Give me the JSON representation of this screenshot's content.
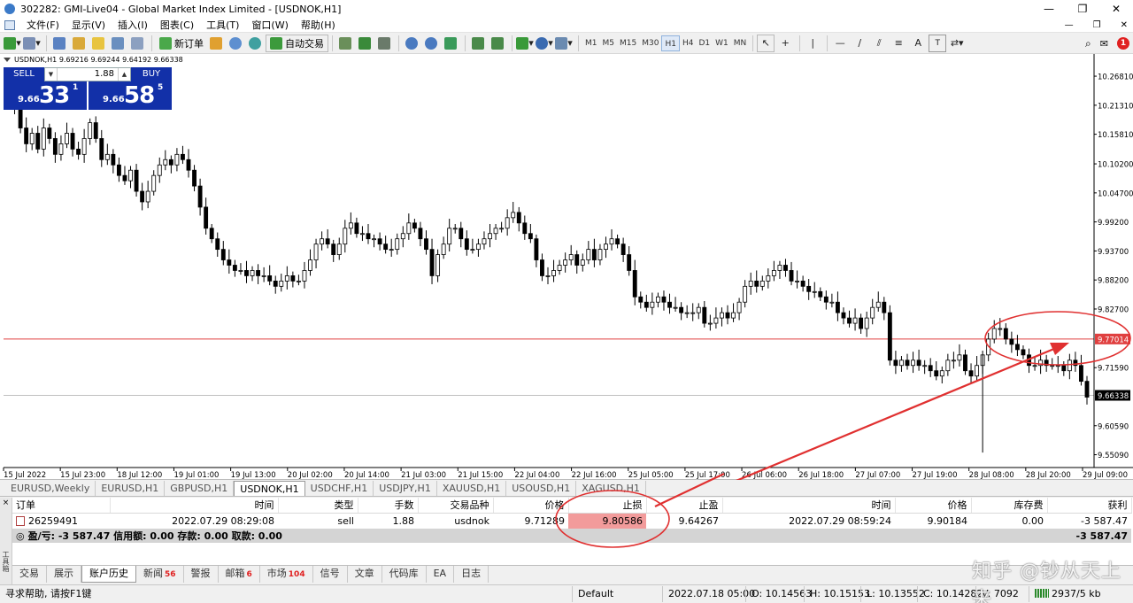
{
  "window": {
    "title": "302282: GMI-Live04 - Global Market Index Limited - [USDNOK,H1]",
    "controls": [
      "—",
      "❐",
      "✕"
    ]
  },
  "menu": {
    "items": [
      "文件(F)",
      "显示(V)",
      "插入(I)",
      "图表(C)",
      "工具(T)",
      "窗口(W)",
      "帮助(H)"
    ],
    "mdi_controls": [
      "—",
      "❐",
      "✕"
    ]
  },
  "toolbar": {
    "new_order_label": "新订单",
    "auto_trading_label": "自动交易",
    "timeframes": [
      "M1",
      "M5",
      "M15",
      "M30",
      "H1",
      "H4",
      "D1",
      "W1",
      "MN"
    ],
    "active_timeframe": "H1",
    "drawing_letters": [
      "A",
      "T"
    ],
    "notification_count": "1"
  },
  "chart": {
    "info_line": "USDNOK,H1  9.69216 9.69244 9.64192 9.66338",
    "colors": {
      "up_candle": "#ffffff",
      "down_candle": "#000000",
      "stop_line": "#e04040",
      "annotation": "#e03030",
      "bid_line": "#c0c0c0"
    },
    "price_labels": [
      "10.26810",
      "10.21310",
      "10.15810",
      "10.10200",
      "10.04700",
      "9.99200",
      "9.93700",
      "9.88200",
      "9.82700",
      "9.77014",
      "9.71590",
      "9.66338",
      "9.60590",
      "9.55090"
    ],
    "time_labels": [
      "15 Jul 2022",
      "15 Jul 23:00",
      "18 Jul 12:00",
      "19 Jul 01:00",
      "19 Jul 13:00",
      "20 Jul 02:00",
      "20 Jul 14:00",
      "21 Jul 03:00",
      "21 Jul 15:00",
      "22 Jul 04:00",
      "22 Jul 16:00",
      "25 Jul 05:00",
      "25 Jul 17:00",
      "26 Jul 06:00",
      "26 Jul 18:00",
      "27 Jul 07:00",
      "27 Jul 19:00",
      "28 Jul 08:00",
      "28 Jul 20:00",
      "29 Jul 09:00"
    ],
    "stop_loss_level": "9.77014",
    "current_price": "9.66338"
  },
  "chart_data": {
    "type": "candlestick",
    "symbol": "USDNOK",
    "timeframe": "H1",
    "ylim": [
      9.53,
      10.29
    ],
    "close_series": [
      10.23,
      10.21,
      10.17,
      10.14,
      10.16,
      10.13,
      10.17,
      10.15,
      10.12,
      10.14,
      10.16,
      10.13,
      10.12,
      10.15,
      10.18,
      10.15,
      10.11,
      10.12,
      10.1,
      10.08,
      10.07,
      10.09,
      10.05,
      10.03,
      10.05,
      10.08,
      10.1,
      10.11,
      10.1,
      10.12,
      10.11,
      10.09,
      10.06,
      10.02,
      9.98,
      9.96,
      9.94,
      9.92,
      9.91,
      9.9,
      9.9,
      9.89,
      9.9,
      9.89,
      9.89,
      9.88,
      9.87,
      9.88,
      9.89,
      9.88,
      9.88,
      9.9,
      9.92,
      9.95,
      9.96,
      9.95,
      9.93,
      9.95,
      9.98,
      9.99,
      9.97,
      9.97,
      9.96,
      9.96,
      9.95,
      9.94,
      9.94,
      9.96,
      9.97,
      9.99,
      9.98,
      9.96,
      9.94,
      9.89,
      9.93,
      9.95,
      9.98,
      9.98,
      9.96,
      9.94,
      9.94,
      9.95,
      9.96,
      9.97,
      9.98,
      9.98,
      10.0,
      10.01,
      9.99,
      9.97,
      9.96,
      9.92,
      9.89,
      9.89,
      9.9,
      9.91,
      9.92,
      9.93,
      9.91,
      9.92,
      9.94,
      9.92,
      9.94,
      9.95,
      9.96,
      9.95,
      9.93,
      9.9,
      9.85,
      9.84,
      9.83,
      9.84,
      9.85,
      9.84,
      9.83,
      9.83,
      9.82,
      9.82,
      9.82,
      9.83,
      9.8,
      9.8,
      9.81,
      9.82,
      9.81,
      9.82,
      9.84,
      9.87,
      9.88,
      9.87,
      9.88,
      9.89,
      9.9,
      9.91,
      9.9,
      9.88,
      9.88,
      9.87,
      9.86,
      9.86,
      9.85,
      9.84,
      9.84,
      9.82,
      9.81,
      9.8,
      9.81,
      9.79,
      9.81,
      9.83,
      9.84,
      9.82,
      9.73,
      9.72,
      9.73,
      9.72,
      9.73,
      9.72,
      9.72,
      9.71,
      9.7,
      9.71,
      9.73,
      9.73,
      9.74,
      9.71,
      9.7,
      9.72,
      9.74,
      9.77,
      9.79,
      9.79,
      9.77,
      9.76,
      9.75,
      9.74,
      9.72,
      9.72,
      9.73,
      9.72,
      9.72,
      9.72,
      9.71,
      9.73,
      9.72,
      9.69,
      9.66
    ],
    "levels": [
      {
        "name": "stop-loss",
        "value": 9.77014
      },
      {
        "name": "bid",
        "value": 9.66338
      }
    ]
  },
  "trade_panel": {
    "sell_label": "SELL",
    "buy_label": "BUY",
    "lot": "1.88",
    "sell_pre": "9.66",
    "sell_big": "33",
    "sell_sup": "1",
    "buy_pre": "9.66",
    "buy_big": "58",
    "buy_sup": "5"
  },
  "symbol_tabs": {
    "items": [
      "EURUSD,Weekly",
      "EURUSD,H1",
      "GBPUSD,H1",
      "USDNOK,H1",
      "USDCHF,H1",
      "USDJPY,H1",
      "XAUUSD,H1",
      "USOUSD,H1",
      "XAGUSD,H1"
    ],
    "active": "USDNOK,H1"
  },
  "terminal": {
    "columns": [
      "订单",
      "时间",
      "类型",
      "手数",
      "交易品种",
      "价格",
      "止损",
      "止盈",
      "时间",
      "价格",
      "库存费",
      "获利"
    ],
    "rows": [
      [
        "26259491",
        "2022.07.29 08:29:08",
        "sell",
        "1.88",
        "usdnok",
        "9.71289",
        "9.80586",
        "9.64267",
        "2022.07.29 08:59:24",
        "9.90184",
        "0.00",
        "-3 587.47"
      ]
    ],
    "summary": "盈/亏: -3 587.47  信用额: 0.00  存款: 0.00  取款: 0.00",
    "summary_profit": "-3 587.47",
    "side_label": "工具箱"
  },
  "bottom_tabs": {
    "items": [
      {
        "label": "交易",
        "count": ""
      },
      {
        "label": "展示",
        "count": ""
      },
      {
        "label": "账户历史",
        "count": ""
      },
      {
        "label": "新闻",
        "count": "56"
      },
      {
        "label": "警报",
        "count": ""
      },
      {
        "label": "邮箱",
        "count": "6"
      },
      {
        "label": "市场",
        "count": "104"
      },
      {
        "label": "信号",
        "count": ""
      },
      {
        "label": "文章",
        "count": ""
      },
      {
        "label": "代码库",
        "count": ""
      },
      {
        "label": "EA",
        "count": ""
      },
      {
        "label": "日志",
        "count": ""
      }
    ],
    "active": "账户历史"
  },
  "statusbar": {
    "help": "寻求帮助, 请按F1键",
    "profile": "Default",
    "datetime": "2022.07.18 05:00",
    "open": "O: 10.14563",
    "high": "H: 10.15153",
    "low": "L: 10.13552",
    "close": "C: 10.14282",
    "volume": "V: 7092",
    "traffic": "2937/5 kb"
  },
  "watermark": "知乎 @钞从天上来"
}
